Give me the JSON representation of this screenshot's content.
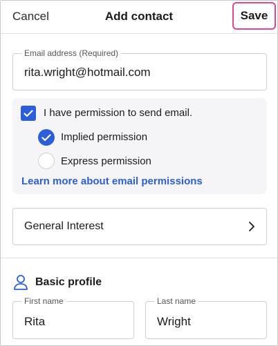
{
  "header": {
    "cancel_label": "Cancel",
    "title": "Add contact",
    "save_label": "Save"
  },
  "email": {
    "label": "Email address (Required)",
    "value": "rita.wright@hotmail.com"
  },
  "permission": {
    "checkbox_label": "I have permission to send email.",
    "checked": true,
    "options": [
      {
        "label": "Implied permission",
        "selected": true
      },
      {
        "label": "Express permission",
        "selected": false
      }
    ],
    "learn_more_label": "Learn more about email permissions"
  },
  "list": {
    "label": "General Interest",
    "icon": "chevron-right-icon"
  },
  "basic_profile": {
    "title": "Basic profile",
    "icon": "user-icon",
    "first_name": {
      "label": "First name",
      "value": "Rita"
    },
    "last_name": {
      "label": "Last name",
      "value": "Wright"
    }
  },
  "colors": {
    "accent": "#2c5edb",
    "save_highlight": "#e8438d",
    "panel_bg": "#f5f5f7"
  }
}
